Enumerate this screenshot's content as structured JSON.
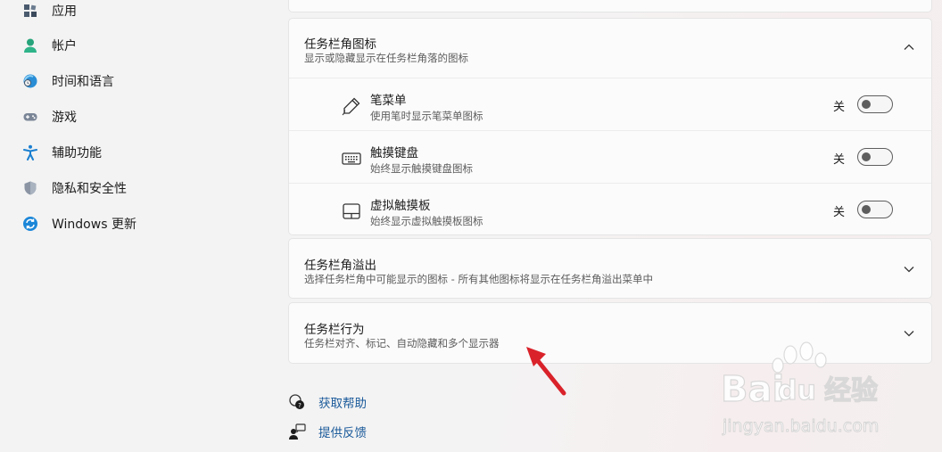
{
  "sidebar": {
    "items": [
      {
        "label": "应用",
        "icon": "apps-icon"
      },
      {
        "label": "帐户",
        "icon": "account-icon"
      },
      {
        "label": "时间和语言",
        "icon": "time-language-icon"
      },
      {
        "label": "游戏",
        "icon": "gaming-icon"
      },
      {
        "label": "辅助功能",
        "icon": "accessibility-icon"
      },
      {
        "label": "隐私和安全性",
        "icon": "privacy-shield-icon"
      },
      {
        "label": "Windows 更新",
        "icon": "windows-update-icon"
      }
    ]
  },
  "sections": {
    "corner_icons": {
      "title": "任务栏角图标",
      "subtitle": "显示或隐藏显示在任务栏角落的图标",
      "expanded": true,
      "items": [
        {
          "title": "笔菜单",
          "subtitle": "使用笔时显示笔菜单图标",
          "state": "关",
          "icon": "pen-icon",
          "on": false
        },
        {
          "title": "触摸键盘",
          "subtitle": "始终显示触摸键盘图标",
          "state": "关",
          "icon": "keyboard-icon",
          "on": false
        },
        {
          "title": "虚拟触摸板",
          "subtitle": "始终显示虚拟触摸板图标",
          "state": "关",
          "icon": "touchpad-icon",
          "on": false
        }
      ]
    },
    "corner_overflow": {
      "title": "任务栏角溢出",
      "subtitle": "选择任务栏角中可能显示的图标 - 所有其他图标将显示在任务栏角溢出菜单中"
    },
    "behaviors": {
      "title": "任务栏行为",
      "subtitle": "任务栏对齐、标记、自动隐藏和多个显示器"
    }
  },
  "links": {
    "help": "获取帮助",
    "feedback": "提供反馈"
  },
  "watermark": {
    "brand_left": "Bai",
    "brand_right": "du",
    "brand_cn": "经验",
    "url": "jingyan.baidu.com"
  },
  "colors": {
    "link": "#1a5a9a",
    "annotation_arrow": "#d9222a",
    "toggle_off": "#5e5e5e"
  }
}
